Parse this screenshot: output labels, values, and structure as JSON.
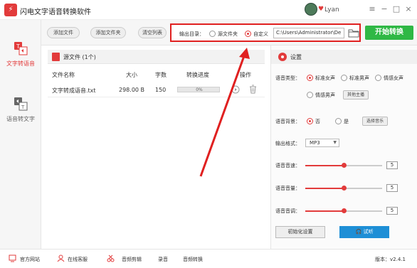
{
  "app": {
    "title": "闪电文字语音转换软件",
    "logo_icon": "app-logo-icon",
    "username": "Lyan",
    "window_controls": [
      "≡",
      "−",
      "□",
      "×"
    ]
  },
  "sidebar": {
    "items": [
      {
        "label": "文字转语音",
        "icon": "text-to-speech-icon",
        "active": true
      },
      {
        "label": "语音转文字",
        "icon": "speech-to-text-icon",
        "active": false
      }
    ]
  },
  "toolbar": {
    "add_file": "添加文件",
    "add_folder": "添加文件夹",
    "clear_list": "清空列表",
    "output_label": "输出目录：",
    "option_source": "源文件夹",
    "option_custom": "自定义",
    "selected_option": "custom",
    "path_value": "C:\\Users\\Administrator\\De",
    "start_button": "开始转换"
  },
  "file_panel": {
    "title": "源文件 (1个)",
    "columns": [
      "文件名称",
      "大小",
      "字数",
      "转换进度",
      "操作"
    ],
    "rows": [
      {
        "name": "文字转成语音.txt",
        "size": "298.00 B",
        "words": "150",
        "progress": "0%",
        "progress_value": 0
      }
    ]
  },
  "settings": {
    "title": "设置",
    "voice_type_label": "语音类型：",
    "voice_options": [
      "标准女声",
      "标准男声",
      "情感女声",
      "情感男声"
    ],
    "voice_selected": "标准女声",
    "more_voices_button": "其他主播",
    "bg_label": "语音背景：",
    "bg_no": "否",
    "bg_yes": "是",
    "bg_selected": "否",
    "choose_music_button": "选择音乐",
    "format_label": "输出格式：",
    "format_value": "MP3",
    "speed_label": "语音音速：",
    "speed_value": "5",
    "volume_label": "语音音量：",
    "volume_value": "5",
    "pitch_label": "语音音调：",
    "pitch_value": "5",
    "slider_fraction": 0.5,
    "init_button": "初始化设置",
    "listen_button": "试听"
  },
  "bottombar": {
    "official_site": "官方网站",
    "online_service": "在线客服",
    "audio_cut": "音频剪辑",
    "record": "录音",
    "audio_convert": "音频转换",
    "version": "版本：v2.4.1"
  },
  "colors": {
    "accent_red": "#e23b3b",
    "start_green": "#2fb845",
    "listen_blue": "#1e8fd6",
    "annotation_red": "#e02020"
  }
}
